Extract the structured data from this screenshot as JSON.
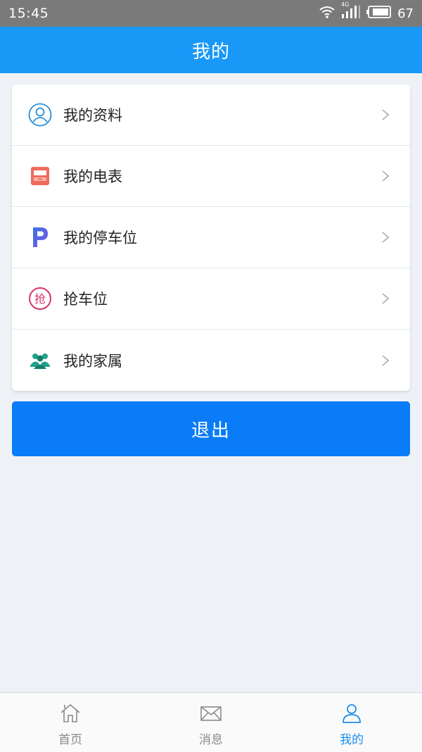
{
  "status_bar": {
    "time": "15:45",
    "network_label": "4G",
    "battery_level": "67"
  },
  "header": {
    "title": "我的"
  },
  "menu": {
    "items": [
      {
        "label": "我的资料",
        "icon": "user-profile-icon"
      },
      {
        "label": "我的电表",
        "icon": "electric-meter-icon"
      },
      {
        "label": "我的停车位",
        "icon": "parking-icon"
      },
      {
        "label": "抢车位",
        "icon": "grab-parking-icon",
        "icon_text": "抢"
      },
      {
        "label": "我的家属",
        "icon": "family-members-icon"
      }
    ]
  },
  "logout": {
    "label": "退出"
  },
  "tabbar": {
    "tabs": [
      {
        "label": "首页",
        "icon": "home-icon",
        "active": false
      },
      {
        "label": "消息",
        "icon": "mail-icon",
        "active": false
      },
      {
        "label": "我的",
        "icon": "person-icon",
        "active": true
      }
    ]
  },
  "colors": {
    "header_bg": "#1a98f7",
    "logout_bg": "#0a7cf7",
    "active_tab": "#1a8ef0",
    "inactive_tab": "#8a8a8a"
  }
}
